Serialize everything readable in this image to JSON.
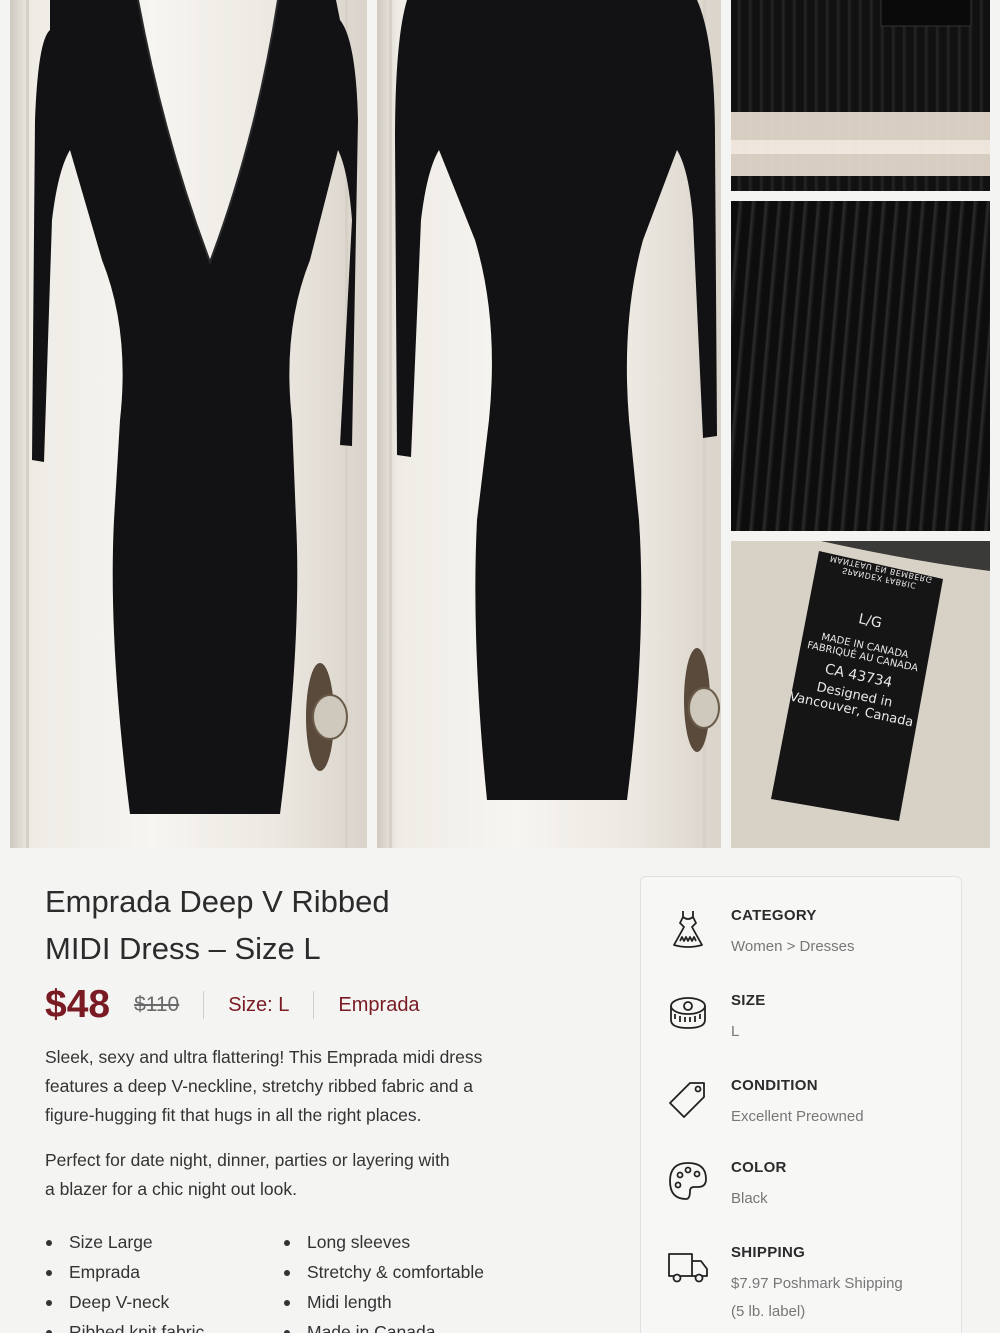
{
  "product": {
    "title_line1": "Emprada Deep V Ribbed",
    "title_line2": "MIDI Dress – Size L",
    "price": "$48",
    "original_price": "$110",
    "size_label": "Size: L",
    "brand": "Emprada",
    "description_p1_l1": "Sleek, sexy and ultra flattering! This Emprada midi dress",
    "description_p1_l2": "features a deep V-neckline, stretchy ribbed fabric and a",
    "description_p1_l3": "figure-hugging fit that hugs in all the right places.",
    "description_p2_l1": "Perfect for date night, dinner, parties or layering with",
    "description_p2_l2": "a blazer for a chic night out look.",
    "bullets_left": [
      "Size Large",
      "Emprada",
      "Deep V-neck",
      "Ribbed knit fabric"
    ],
    "bullets_right": [
      "Long sleeves",
      "Stretchy & comfortable",
      "Midi length",
      "Made in Canada"
    ]
  },
  "care_label": {
    "top_line1": "MANTEAU EN BEMBERG",
    "top_line2": "SPANDEX FABRIC",
    "size": "L/G",
    "made1": "MADE IN CANADA",
    "made2": "FABRIQUÉ AU CANADA",
    "ca": "CA 43734",
    "designed1": "Designed in",
    "designed2": "Vancouver, Canada"
  },
  "details": {
    "category_label": "CATEGORY",
    "category_value": "Women > Dresses",
    "size_label": "SIZE",
    "size_value": "L",
    "condition_label": "CONDITION",
    "condition_value": "Excellent Preowned",
    "color_label": "COLOR",
    "color_value": "Black",
    "shipping_label": "SHIPPING",
    "shipping_value_l1": "$7.97 Poshmark Shipping",
    "shipping_value_l2": "(5 lb. label)"
  },
  "icons": [
    "dress-icon",
    "measuring-tape-icon",
    "tag-icon",
    "palette-icon",
    "truck-icon"
  ],
  "colors": {
    "accent": "#7a1b24",
    "background": "#f4f4f3"
  }
}
